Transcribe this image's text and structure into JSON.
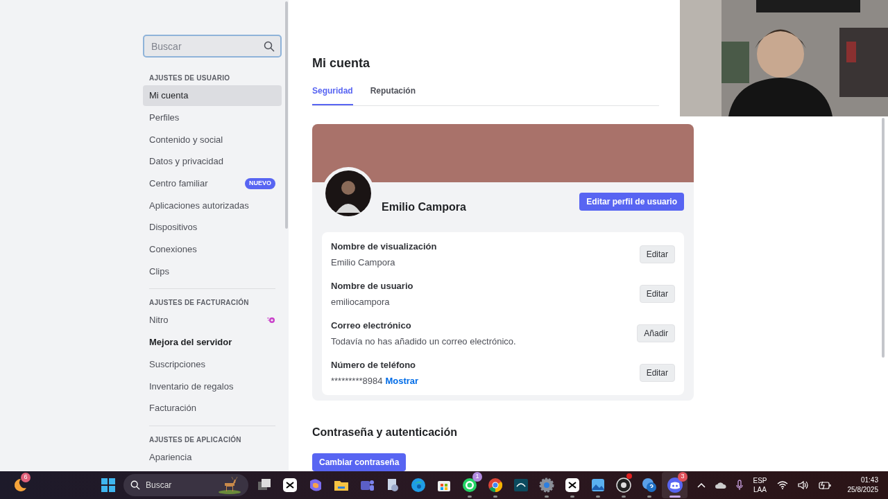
{
  "sidebar": {
    "search": {
      "placeholder": "Buscar"
    },
    "sections": [
      {
        "heading": "AJUSTES DE USUARIO",
        "items": [
          {
            "label": "Mi cuenta",
            "selected": true
          },
          {
            "label": "Perfiles",
            "selected": false
          },
          {
            "label": "Contenido y social",
            "selected": false
          },
          {
            "label": "Datos y privacidad",
            "selected": false
          },
          {
            "label": "Centro familiar",
            "selected": false,
            "badge": "NUEVO"
          },
          {
            "label": "Aplicaciones autorizadas",
            "selected": false
          },
          {
            "label": "Dispositivos",
            "selected": false
          },
          {
            "label": "Conexiones",
            "selected": false
          },
          {
            "label": "Clips",
            "selected": false
          }
        ]
      },
      {
        "heading": "AJUSTES DE FACTURACIÓN",
        "items": [
          {
            "label": "Nitro",
            "selected": false,
            "kind": "nitro"
          },
          {
            "label": "Mejora del servidor",
            "selected": false,
            "hovered": true,
            "kind": "plain"
          },
          {
            "label": "Suscripciones",
            "selected": false,
            "kind": "plain"
          },
          {
            "label": "Inventario de regalos",
            "selected": false,
            "kind": "plain"
          },
          {
            "label": "Facturación",
            "selected": false,
            "kind": "plain"
          }
        ]
      },
      {
        "heading": "AJUSTES DE APLICACIÓN",
        "items": [
          {
            "label": "Apariencia",
            "selected": false
          }
        ]
      }
    ]
  },
  "main": {
    "title": "Mi cuenta",
    "tabs": [
      {
        "label": "Seguridad",
        "selected": true
      },
      {
        "label": "Reputación",
        "selected": false
      }
    ],
    "profile": {
      "name": "Emilio Campora",
      "edit_button": "Editar perfil de usuario",
      "fields": [
        {
          "label": "Nombre de visualización",
          "value": "Emilio Campora",
          "button": "Editar"
        },
        {
          "label": "Nombre de usuario",
          "value": "emiliocampora",
          "button": "Editar"
        },
        {
          "label": "Correo electrónico",
          "value": "Todavía no has añadido un correo electrónico.",
          "button": "Añadir"
        },
        {
          "label": "Número de teléfono",
          "value": "*********8984",
          "link": "Mostrar",
          "button": "Editar"
        }
      ]
    },
    "password_section": {
      "title": "Contraseña y autenticación",
      "button": "Cambiar contraseña"
    }
  },
  "taskbar": {
    "left_app": {
      "kind": "weather",
      "badge": "6"
    },
    "search": {
      "placeholder": "Buscar"
    },
    "apps": [
      {
        "kind": "start",
        "running": false,
        "selected": false
      },
      {
        "kind": "taskview",
        "running": false,
        "selected": false
      },
      {
        "kind": "capcut",
        "running": false,
        "selected": false
      },
      {
        "kind": "copilot",
        "running": false,
        "selected": false
      },
      {
        "kind": "folder",
        "running": false,
        "selected": false
      },
      {
        "kind": "teams",
        "running": false,
        "selected": false
      },
      {
        "kind": "installer",
        "running": false,
        "selected": false
      },
      {
        "kind": "edge",
        "running": false,
        "selected": false
      },
      {
        "kind": "store",
        "running": false,
        "selected": false
      },
      {
        "kind": "whatsapp",
        "running": true,
        "selected": false,
        "badge": "1"
      },
      {
        "kind": "chrome",
        "running": true,
        "selected": false
      },
      {
        "kind": "disney",
        "running": false,
        "selected": false
      },
      {
        "kind": "settings",
        "running": true,
        "selected": false
      },
      {
        "kind": "capcut",
        "running": true,
        "selected": false
      },
      {
        "kind": "photos",
        "running": true,
        "selected": false
      },
      {
        "kind": "obs",
        "running": true,
        "selected": false,
        "dot": true
      },
      {
        "kind": "help",
        "running": true,
        "selected": false
      },
      {
        "kind": "discord",
        "running": true,
        "selected": true,
        "badge": "3"
      }
    ],
    "language": [
      "ESP",
      "LAA"
    ],
    "time": "01:43",
    "date": "25/8/2025"
  }
}
